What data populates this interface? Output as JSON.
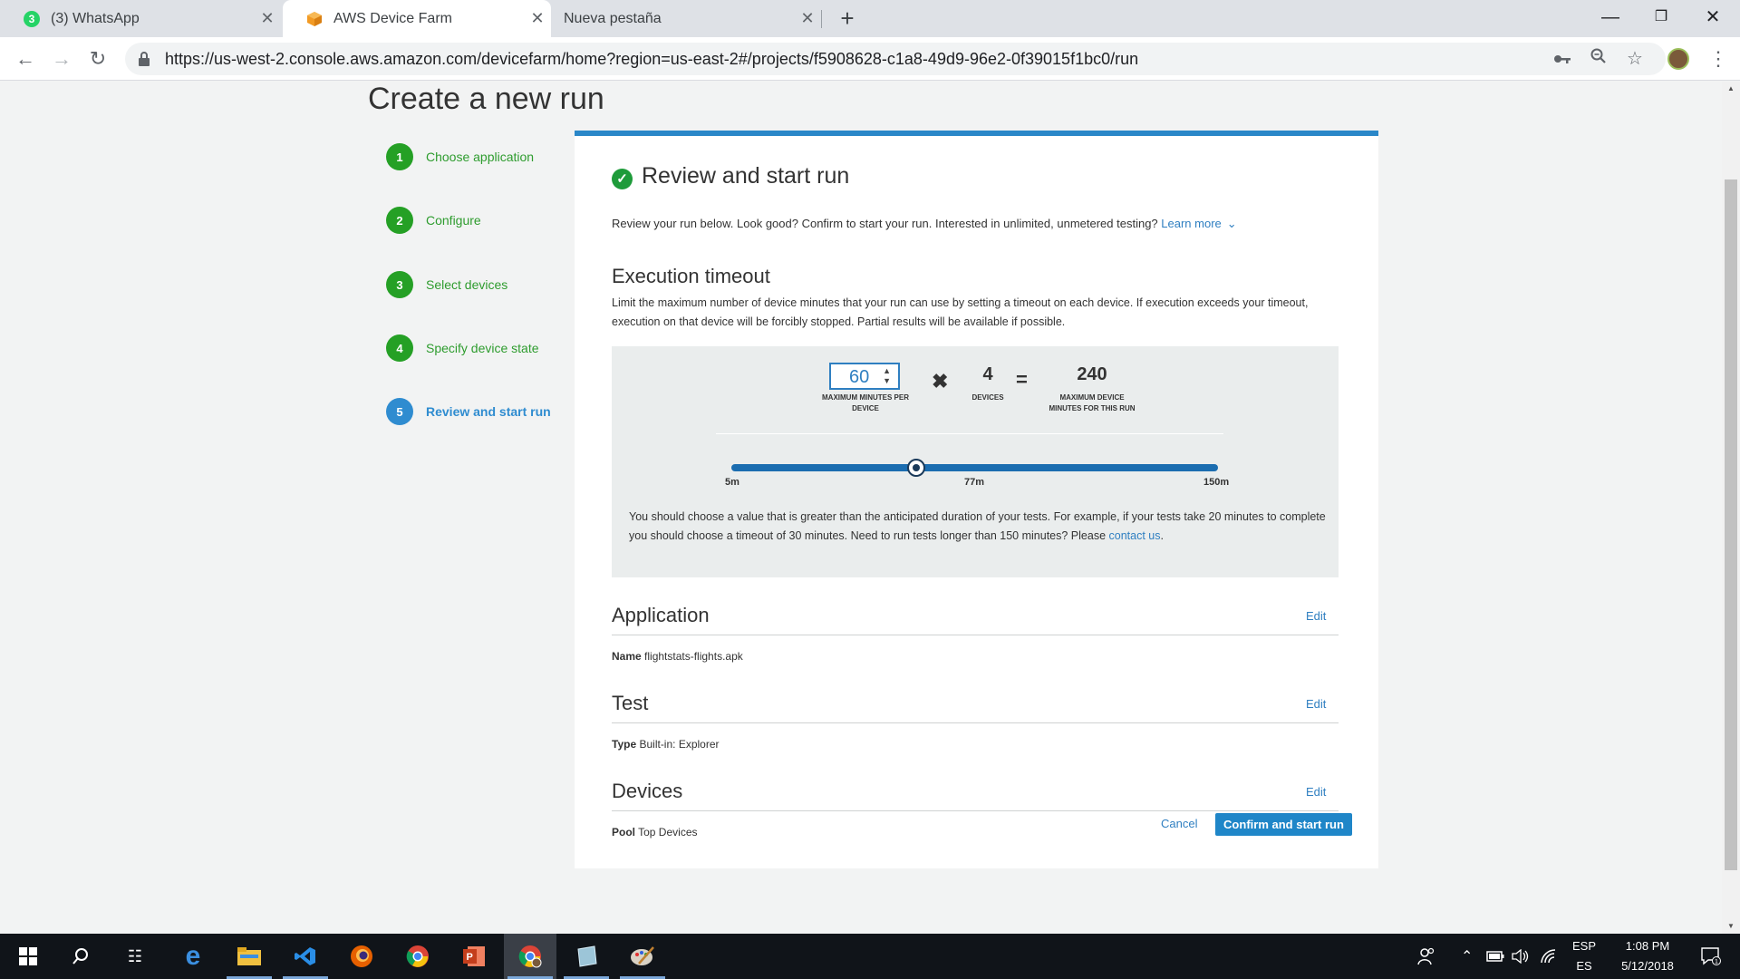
{
  "browser": {
    "tabs": [
      {
        "title": "(3) WhatsApp",
        "badge": "3",
        "active": false
      },
      {
        "title": "AWS Device Farm",
        "active": true
      },
      {
        "title": "Nueva pestaña",
        "active": false
      }
    ],
    "url": "https://us-west-2.console.aws.amazon.com/devicefarm/home?region=us-east-2#/projects/f5908628-c1a8-49d9-96e2-0f39015f1bc0/run"
  },
  "page": {
    "title": "Create a new run",
    "steps": [
      {
        "num": "1",
        "label": "Choose application"
      },
      {
        "num": "2",
        "label": "Configure"
      },
      {
        "num": "3",
        "label": "Select devices"
      },
      {
        "num": "4",
        "label": "Specify device state"
      },
      {
        "num": "5",
        "label": "Review and start run",
        "current": true
      }
    ],
    "review": {
      "heading": "Review and start run",
      "intro": "Review your run below. Look good? Confirm to start your run. Interested in unlimited, unmetered testing?",
      "learn_more": "Learn more"
    },
    "timeout": {
      "heading": "Execution timeout",
      "description": "Limit the maximum number of device minutes that your run can use by setting a timeout on each device. If execution exceeds your timeout, execution on that device will be forcibly stopped. Partial results will be available if possible.",
      "minutes_value": "60",
      "minutes_caption": "MAXIMUM MINUTES PER DEVICE",
      "times_symbol": "✖",
      "devices_value": "4",
      "devices_caption": "DEVICES",
      "equals_symbol": "=",
      "total_value": "240",
      "total_caption": "MAXIMUM DEVICE MINUTES FOR THIS RUN",
      "slider": {
        "min_label": "5m",
        "mid_label": "77m",
        "max_label": "150m",
        "value_minutes": 60
      },
      "note": "You should choose a value that is greater than the anticipated duration of your tests. For example, if your tests take 20 minutes to complete you should choose a timeout of 30 minutes. Need to run tests longer than 150 minutes? Please",
      "contact_link": "contact us",
      "note_end": "."
    },
    "sections": {
      "application": {
        "heading": "Application",
        "edit": "Edit",
        "key": "Name",
        "value": "flightstats-flights.apk"
      },
      "test": {
        "heading": "Test",
        "edit": "Edit",
        "key": "Type",
        "value": "Built-in: Explorer"
      },
      "devices": {
        "heading": "Devices",
        "edit": "Edit",
        "key": "Pool",
        "value": "Top Devices"
      }
    },
    "actions": {
      "cancel": "Cancel",
      "confirm": "Confirm and start run"
    }
  },
  "taskbar": {
    "language_top": "ESP",
    "language_bottom": "ES",
    "time": "1:08 PM",
    "date": "5/12/2018",
    "notification_count": "1"
  },
  "colors": {
    "accent": "#2a87c8",
    "step_complete": "#25a025",
    "step_current": "#2f8cd0",
    "primary_button": "#1f86c8"
  }
}
